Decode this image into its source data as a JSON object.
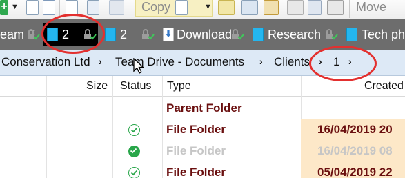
{
  "toolbar": {
    "copy_label": "Copy",
    "move_label": "Move"
  },
  "tabs": [
    {
      "label": "eam F",
      "bar_color": "#e8e8e8",
      "active": false
    },
    {
      "label": "2",
      "bar_color": "#2fd3ff",
      "active": true
    },
    {
      "label": "2",
      "bar_color": "#2fd3ff",
      "active": false
    },
    {
      "label": "Download",
      "bar_color": "#e21d1d",
      "active": false
    },
    {
      "label": "Research",
      "bar_color": "#21d13a",
      "active": false
    },
    {
      "label": "Tech phot",
      "bar_color": "#2fd3ff",
      "active": false
    }
  ],
  "breadcrumb": {
    "items": [
      "Conservation Ltd",
      "Team Drive - Documents",
      "Clients",
      "1"
    ]
  },
  "columns": {
    "size": "Size",
    "status": "Status",
    "type": "Type",
    "created": "Created"
  },
  "rows": [
    {
      "type": "Parent Folder",
      "created": "",
      "status": "none",
      "hidden": false
    },
    {
      "type": "File Folder",
      "created": "16/04/2019  20",
      "status": "synced-outline",
      "hidden": false
    },
    {
      "type": "File Folder",
      "created": "16/04/2019  08",
      "status": "synced-filled",
      "hidden": true
    },
    {
      "type": "File Folder",
      "created": "05/04/2019  22",
      "status": "synced-outline",
      "hidden": false
    }
  ],
  "colors": {
    "accent_tab": "#2fd3ff",
    "annotation": "#e3302f",
    "folder_text": "#6a0f0f",
    "status_green": "#29a64a",
    "breadcrumb_bg": "#dde9f6"
  }
}
